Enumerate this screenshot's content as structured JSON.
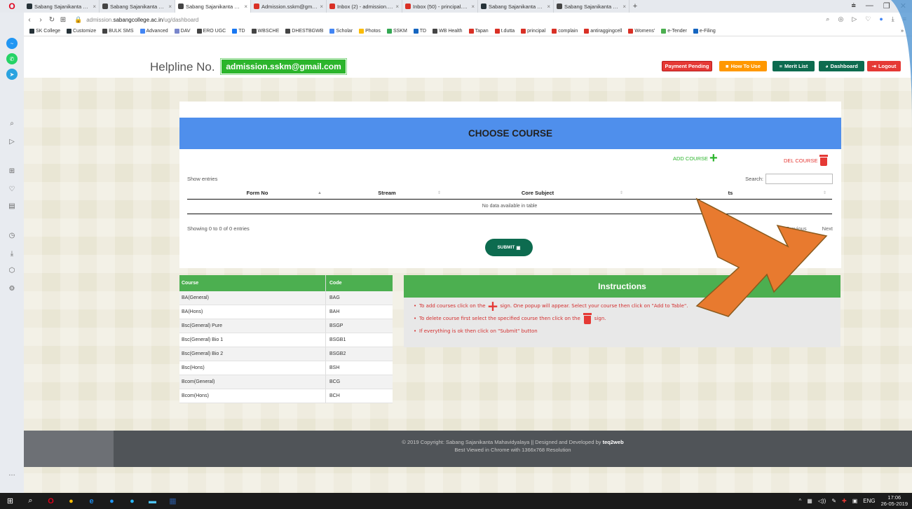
{
  "browser": {
    "tabs": [
      {
        "title": "Sabang Sajanikanta Maha",
        "color": "#263238",
        "active": false
      },
      {
        "title": "Sabang Sajanikanta Maha",
        "color": "#444",
        "active": false
      },
      {
        "title": "Sabang Sajanikanta Maha",
        "color": "#444",
        "active": true
      },
      {
        "title": "Admission.sskm@gmail.co",
        "color": "#d93025",
        "active": false
      },
      {
        "title": "Inbox (2) - admission.sskm",
        "color": "#d93025",
        "active": false
      },
      {
        "title": "Inbox (50) - principal.sskm",
        "color": "#d93025",
        "active": false
      },
      {
        "title": "Sabang Sajanikanta Maha",
        "color": "#263238",
        "active": false
      },
      {
        "title": "Sabang Sajanikanta Maha",
        "color": "#444",
        "active": false
      }
    ],
    "tab_close": "×",
    "new_tab": "+",
    "url_prefix": "admission.",
    "url_domain": "sabangcollege.ac.in",
    "url_path": "/ug/dashboard",
    "bookmarks": [
      {
        "label": "SK College",
        "color": "#263238"
      },
      {
        "label": "Customize",
        "color": "#263238"
      },
      {
        "label": "BULK SMS",
        "color": "#444"
      },
      {
        "label": "Advanced",
        "color": "#4285f4"
      },
      {
        "label": "DAV",
        "color": "#7986cb"
      },
      {
        "label": "ERO UGC",
        "color": "#444"
      },
      {
        "label": "TD",
        "color": "#1877f2"
      },
      {
        "label": "WBSCHE",
        "color": "#444"
      },
      {
        "label": "DHESTBGWB",
        "color": "#444"
      },
      {
        "label": "Scholar",
        "color": "#4285f4"
      },
      {
        "label": "Photos",
        "color": "#fbbc05"
      },
      {
        "label": "SSKM",
        "color": "#34a853"
      },
      {
        "label": "TD",
        "color": "#1565c0"
      },
      {
        "label": "WB Health",
        "color": "#444"
      },
      {
        "label": "Tapan",
        "color": "#d93025"
      },
      {
        "label": "t.dutta",
        "color": "#d93025"
      },
      {
        "label": "principal",
        "color": "#d93025"
      },
      {
        "label": "complain",
        "color": "#d93025"
      },
      {
        "label": "antiraggingcell",
        "color": "#d93025"
      },
      {
        "label": "Womens'",
        "color": "#d93025"
      },
      {
        "label": "e-Tender",
        "color": "#4caf50"
      },
      {
        "label": "e-Filing",
        "color": "#1565c0"
      }
    ],
    "bookmarks_more": "»"
  },
  "header": {
    "helpline_label": "Helpline No.",
    "helpline_email": "admission.sskm@gmail.com",
    "buttons": {
      "payment": "Payment Pending",
      "how_to_use": "How To Use",
      "merit_list": "Merit List",
      "dashboard": "Dashboard",
      "logout": "Logout"
    }
  },
  "choose_course": {
    "title": "CHOOSE COURSE",
    "add_course": "ADD COURSE",
    "del_course": "DEL COURSE",
    "show_entries": "Show entries",
    "search_label": "Search:",
    "columns": [
      "Form No",
      "Stream",
      "Core Subject",
      "ts"
    ],
    "no_data": "No data available in table",
    "showing": "Showing 0 to 0 of 0 entries",
    "previous": "Previous",
    "next": "Next",
    "submit": "SUBMIT"
  },
  "course_table": {
    "headers": [
      "Course",
      "Code"
    ],
    "rows": [
      [
        "BA(General)",
        "BAG"
      ],
      [
        "BA(Hons)",
        "BAH"
      ],
      [
        "Bsc(General) Pure",
        "BSGP"
      ],
      [
        "Bsc(General) Bio 1",
        "BSGB1"
      ],
      [
        "Bsc(General) Bio 2",
        "BSGB2"
      ],
      [
        "Bsc(Hons)",
        "BSH"
      ],
      [
        "Bcom(General)",
        "BCG"
      ],
      [
        "Bcom(Hons)",
        "BCH"
      ]
    ]
  },
  "instructions": {
    "title": "Instructions",
    "item1_a": "To add courses click on the",
    "item1_b": "sign. One popup will appear. Select your course then click on \"Add to Table\".",
    "item2_a": "To delete course first select the specified course then click on the",
    "item2_b": "sign.",
    "item3": "If everything is ok then click on \"Submit\" button"
  },
  "footer": {
    "line1_prefix": "© 2019 Copyright: Sabang Sajanikanta Mahavidyalaya || Designed and Developed by",
    "line1_brand": "teq2web",
    "line2": "Best Viewed in Chrome with 1366x768 Resolution"
  },
  "taskbar": {
    "lang": "ENG",
    "time": "17:06",
    "date": "26-05-2019"
  },
  "colors": {
    "header_blue": "#4f8fec",
    "green": "#4caf50",
    "arrow": "#e87a2f",
    "submit": "#0d6b4f"
  }
}
